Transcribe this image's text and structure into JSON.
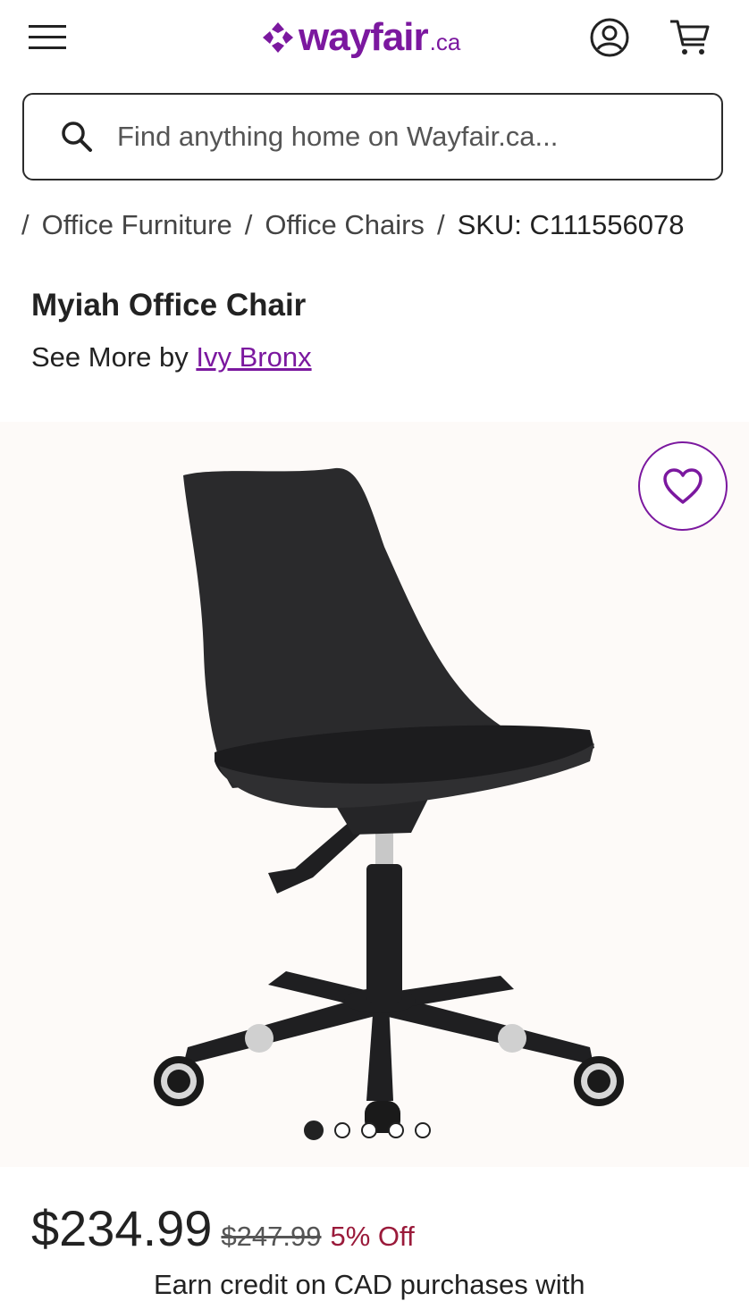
{
  "header": {
    "logo_word": "wayfair",
    "logo_tld": ".ca",
    "brand_color": "#7b189f",
    "icons": [
      "menu-icon",
      "account-icon",
      "cart-icon"
    ]
  },
  "search": {
    "placeholder": "Find anything home on Wayfair.ca..."
  },
  "breadcrumb": {
    "items": [
      "Office Furniture",
      "Office Chairs"
    ],
    "current": "SKU: C111556078"
  },
  "product": {
    "title": "Myiah Office Chair",
    "see_more_prefix": "See More by ",
    "brand": "Ivy Bronx"
  },
  "gallery": {
    "image_count": 5,
    "active_index": 0,
    "favorite_icon": "heart-icon"
  },
  "pricing": {
    "price": "$234.99",
    "original_price": "$247.99",
    "discount": "5% Off",
    "discount_color": "#9a1a3a",
    "next_line": "Earn credit on CAD purchases with"
  }
}
